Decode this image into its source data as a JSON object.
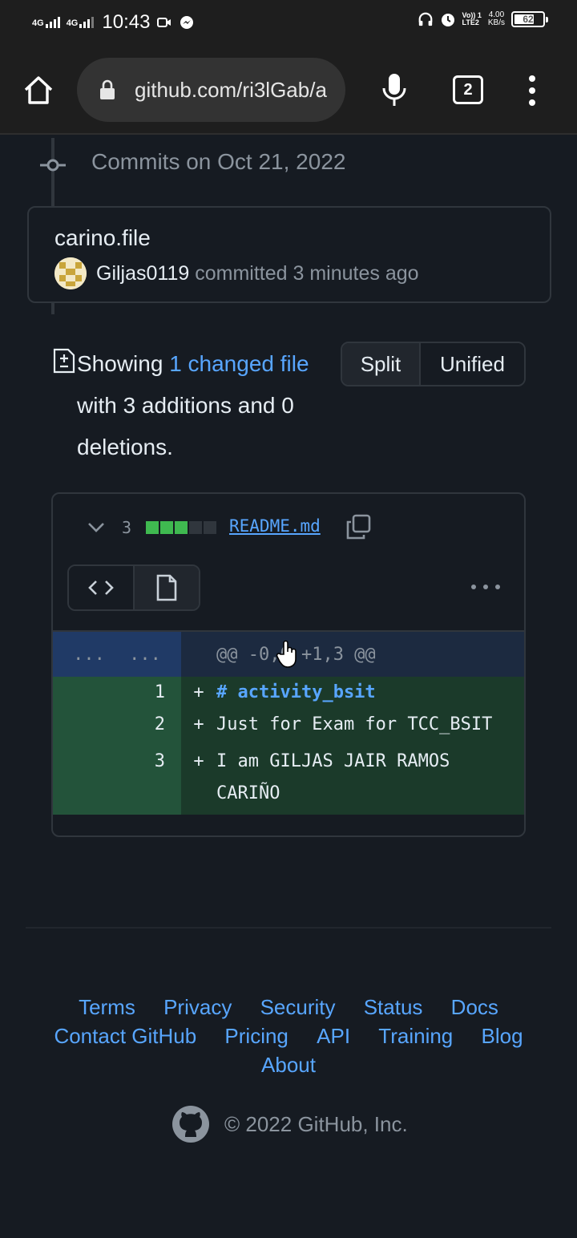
{
  "status_bar": {
    "network_1": "4G",
    "network_2": "4G",
    "time": "10:43",
    "volte_1": "Vo)) 1",
    "volte_2": "LTE2",
    "speed_value": "4.00",
    "speed_unit": "KB/s",
    "battery": "62"
  },
  "browser": {
    "url": "github.com/ri3lGab/a",
    "tab_count": "2"
  },
  "timeline": {
    "heading": "Commits on Oct 21, 2022"
  },
  "commit": {
    "title": "carino.file",
    "author": "Giljas0119",
    "meta": " committed 3 minutes ago"
  },
  "summary": {
    "showing": "Showing ",
    "link": "1 changed file",
    "rest": " with 3 additions and 0 deletions."
  },
  "view_toggle": {
    "split": "Split",
    "unified": "Unified"
  },
  "file": {
    "diffstat": "3",
    "diffstat_blocks": [
      "add",
      "add",
      "add",
      "neutral",
      "neutral"
    ],
    "name": "README.md",
    "hunk_left": "...",
    "hunk_right": "...",
    "hunk_header": "@@ -0,0 +1,3 @@",
    "lines": [
      {
        "num": "1",
        "sign": "+",
        "text": "# activity_bsit"
      },
      {
        "num": "2",
        "sign": "+",
        "text": "Just for Exam for TCC_BSIT"
      },
      {
        "num": "3",
        "sign": "+",
        "text": "I am GILJAS JAIR RAMOS CARIÑO"
      }
    ]
  },
  "footer": {
    "links": [
      "Terms",
      "Privacy",
      "Security",
      "Status",
      "Docs",
      "Contact GitHub",
      "Pricing",
      "API",
      "Training",
      "Blog",
      "About"
    ],
    "copyright": "© 2022 GitHub, Inc."
  },
  "colors": {
    "background": "#161b22",
    "link": "#58a6ff",
    "addition_green": "#3fb950",
    "addition_row": "#1b3a2a"
  }
}
